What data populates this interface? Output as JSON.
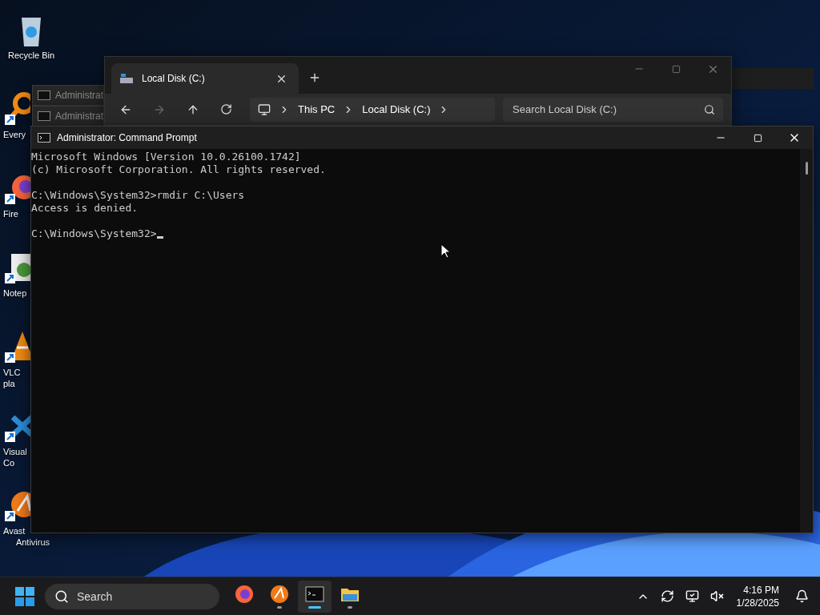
{
  "desktop_icons": [
    {
      "kind": "recycle",
      "shortcut": false,
      "lines": [
        "Recycle Bin"
      ]
    },
    {
      "kind": "everything",
      "shortcut": true,
      "lines": [
        "Every"
      ]
    },
    {
      "kind": "firefox",
      "shortcut": true,
      "lines": [
        "Fire"
      ]
    },
    {
      "kind": "notepad",
      "shortcut": true,
      "lines": [
        "Notep"
      ]
    },
    {
      "kind": "vlc",
      "shortcut": true,
      "lines": [
        "VLC",
        "pla"
      ]
    },
    {
      "kind": "vscode",
      "shortcut": true,
      "lines": [
        "Visual",
        "Co"
      ]
    },
    {
      "kind": "avast",
      "shortcut": true,
      "lines": [
        "Avast",
        "Antivirus"
      ]
    }
  ],
  "background_windows": [
    {
      "title": "Administrat"
    },
    {
      "title": "Administrat"
    }
  ],
  "explorer": {
    "tabs": [
      {
        "label": "Local Disk (C:)",
        "selected": true
      }
    ],
    "forward_disabled": true,
    "breadcrumb": [
      "This PC",
      "Local Disk (C:)"
    ],
    "search": {
      "placeholder": "Search Local Disk (C:)"
    }
  },
  "console": {
    "title": "Administrator: Command Prompt",
    "blocks": [
      [
        "Microsoft Windows [Version 10.0.26100.1742]",
        "(c) Microsoft Corporation. All rights reserved."
      ],
      [
        "C:\\Windows\\System32>rmdir C:\\Users",
        "Access is denied."
      ],
      [
        "C:\\Windows\\System32>"
      ]
    ]
  },
  "taskbar": {
    "search": {
      "placeholder": "Search"
    },
    "apps": [
      {
        "kind": "firefox",
        "running": false,
        "selected": false
      },
      {
        "kind": "avast",
        "running": true,
        "selected": false
      },
      {
        "kind": "terminal",
        "running": true,
        "selected": true
      },
      {
        "kind": "folder",
        "running": true,
        "selected": false
      }
    ],
    "clock": {
      "time": "4:16 PM",
      "date": "1/28/2025"
    }
  }
}
